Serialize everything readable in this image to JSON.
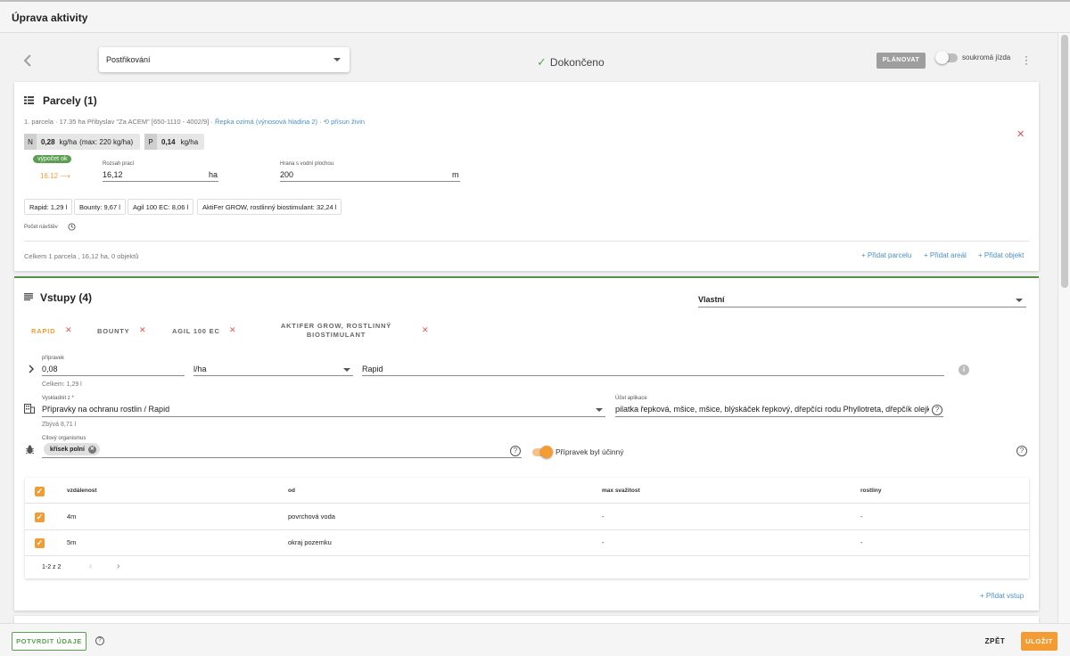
{
  "window": {
    "title": "Úprava aktivity"
  },
  "header": {
    "activity_type": "Postřikování",
    "status": "Dokončeno",
    "plan_label": "PLÁNOVAT",
    "private_ride_label": "soukromá jízda"
  },
  "parcels": {
    "title": "Parcely (1)",
    "parcel_prefix": "1. parcela",
    "parcel_desc": "17.35 ha Přibyslav \"Za ACEM\" [650-1110 - 4002/9]",
    "crop": "Řepka ozimá",
    "yield_level": "(výnosová hladina 2)",
    "nutrient_link": "přísun živin",
    "nutrients": [
      {
        "key": "N",
        "value": "0,28",
        "unit": "kg/ha",
        "extra": "(max: 220 kg/ha)"
      },
      {
        "key": "P",
        "value": "0,14",
        "unit": "kg/ha",
        "extra": ""
      }
    ],
    "calc_badge": "výpočet ok",
    "calc_value": "16.12 ⟶",
    "work_range": {
      "label": "Rozsah prací",
      "value": "16,12",
      "unit": "ha"
    },
    "water_edge": {
      "label": "Hrana s vodní plochou",
      "value": "200",
      "unit": "m"
    },
    "product_tags": [
      "Rapid: 1,29 l",
      "Bounty: 9,67 l",
      "Agil 100 EC: 8,06 l",
      "AktiFer GROW, rostlinný biostimulant: 32,24 l"
    ],
    "visits_label": "Počet návštěv",
    "summary": "Celkem 1 parcela , 16,12 ha, 0 objektů",
    "add_parcel": "Přidat parcelu",
    "add_area": "Přidat areál",
    "add_object": "Přidat objekt"
  },
  "inputs": {
    "title": "Vstupy (4)",
    "mode_value": "Vlastní",
    "tabs": [
      "RAPID",
      "BOUNTY",
      "AGIL 100 EC",
      "AKTIFER GROW, ROSTLINNÝ BIOSTIMULANT"
    ],
    "active_tab": 0,
    "preparation": {
      "label": "přípravek",
      "dose": "0,08",
      "unit": "l/ha",
      "name": "Rapid",
      "total": "Celkem: 1,29 l"
    },
    "stock": {
      "label": "Vyskladnit z *",
      "value": "Přípravky na ochranu rostlin / Rapid",
      "remaining": "Zbývá 8,71 l"
    },
    "purpose": {
      "label": "Účel aplikace",
      "value": "pilatka řepková, mšice, mšice, blýskáček řepkový, dřepčíci rodu Phyllotreta, dřepčík olejk"
    },
    "target": {
      "label": "Cílový organismus",
      "chip": "křísek polní"
    },
    "effective_label": "Přípravek byl účinný",
    "table": {
      "headers": [
        "vzdálenost",
        "od",
        "max svažitost",
        "rostliny"
      ],
      "rows": [
        [
          "4m",
          "povrchová voda",
          "-",
          "-"
        ],
        [
          "5m",
          "okraj pozemku",
          "-",
          "-"
        ]
      ],
      "pagination": "1-2 z 2"
    },
    "add_input": "Přidat vstup"
  },
  "footer": {
    "confirm_label": "POTVRDIT ÚDAJE",
    "back_label": "ZPĚT",
    "save_label": "ULOŽIT"
  },
  "colors": {
    "accent": "#f39c33",
    "success": "#5a9e4f",
    "danger": "#e05353",
    "link": "#4a90c8"
  },
  "icons": [
    "chevron-left-icon",
    "check-icon",
    "parcels-grid-icon",
    "history-icon",
    "close-icon",
    "clock-icon",
    "list-icon",
    "chevron-right-icon",
    "info-icon",
    "warehouse-icon",
    "help-icon",
    "bug-icon",
    "plus-icon"
  ]
}
